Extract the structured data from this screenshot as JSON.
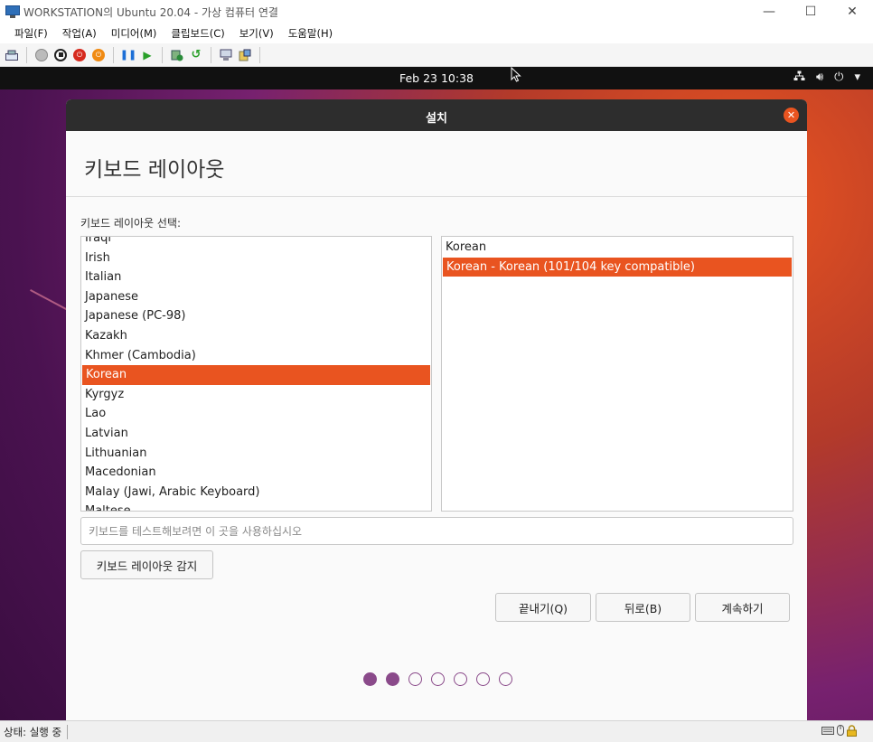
{
  "window": {
    "title": "WORKSTATION의 Ubuntu 20.04 - 가상 컴퓨터 연결",
    "minimize": "—",
    "maximize": "☐",
    "close": "✕"
  },
  "menu": [
    "파일(F)",
    "작업(A)",
    "미디어(M)",
    "클립보드(C)",
    "보기(V)",
    "도움말(H)"
  ],
  "guest_topbar": {
    "clock": "Feb 23  10:38"
  },
  "dialog": {
    "title": "설치",
    "heading": "키보드 레이아웃",
    "select_label": "키보드 레이아웃 선택:",
    "layouts": [
      "Iraqi",
      "Irish",
      "Italian",
      "Japanese",
      "Japanese (PC-98)",
      "Kazakh",
      "Khmer (Cambodia)",
      "Korean",
      "Kyrgyz",
      "Lao",
      "Latvian",
      "Lithuanian",
      "Macedonian",
      "Malay (Jawi, Arabic Keyboard)",
      "Maltese"
    ],
    "selected_layout": "Korean",
    "variants": [
      "Korean",
      "Korean - Korean (101/104 key compatible)"
    ],
    "selected_variant": "Korean - Korean (101/104 key compatible)",
    "test_placeholder": "키보드를 테스트해보려면 이 곳을 사용하십시오",
    "detect_button": "키보드 레이아웃 감지",
    "quit_button": "끝내기(Q)",
    "back_button": "뒤로(B)",
    "continue_button": "계속하기",
    "progress_step": 2,
    "progress_total": 7
  },
  "status": {
    "text": "상태: 실행 중"
  },
  "colors": {
    "accent": "#e95420",
    "dialog_header": "#2d2d2d",
    "progress_dot": "#8a4a8a"
  }
}
